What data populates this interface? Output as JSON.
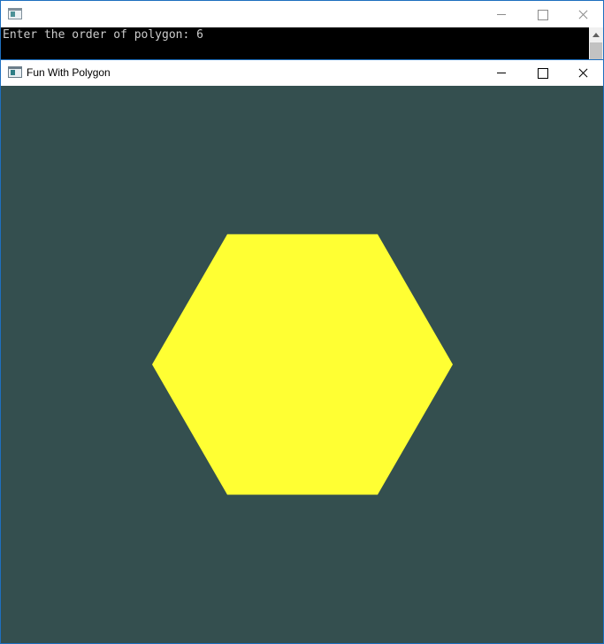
{
  "console_window": {
    "title": "",
    "output_line": "Enter the order of polygon: 6"
  },
  "polygon_window": {
    "title": "Fun With Polygon",
    "canvas": {
      "background_color": "#344f4f",
      "polygon": {
        "order": 6,
        "fill_color": "#ffff33"
      }
    }
  },
  "icons": {
    "app": "app-window-icon",
    "minimize": "minimize-icon",
    "maximize": "maximize-icon",
    "close": "close-icon"
  }
}
